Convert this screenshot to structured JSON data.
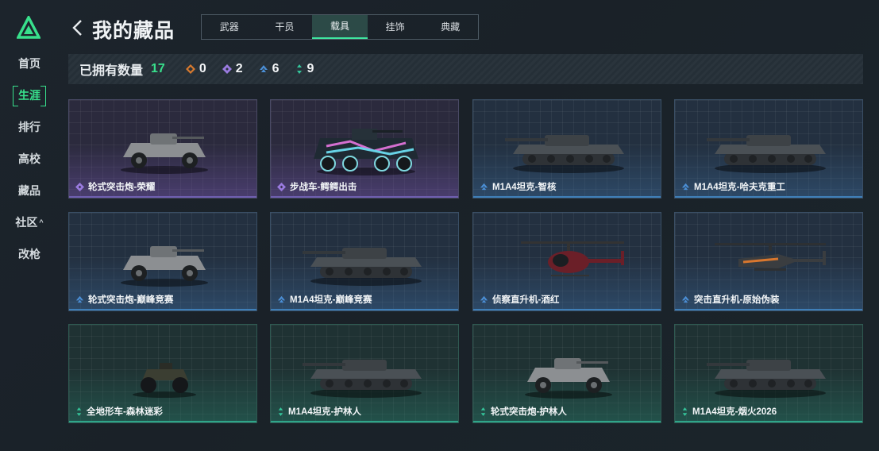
{
  "sidebar": {
    "logo_icon": "triangle-logo-icon",
    "items": [
      {
        "label": "首页",
        "active": false
      },
      {
        "label": "生涯",
        "active": true
      },
      {
        "label": "排行",
        "active": false
      },
      {
        "label": "高校",
        "active": false
      },
      {
        "label": "藏品",
        "active": false
      },
      {
        "label": "社区",
        "active": false,
        "caret": "^"
      },
      {
        "label": "改枪",
        "active": false
      }
    ]
  },
  "header": {
    "back_icon": "chevron-left-icon",
    "title": "我的藏品",
    "tabs": [
      {
        "label": "武器",
        "active": false
      },
      {
        "label": "干员",
        "active": false
      },
      {
        "label": "载具",
        "active": true
      },
      {
        "label": "挂饰",
        "active": false
      },
      {
        "label": "典藏",
        "active": false
      }
    ]
  },
  "stats": {
    "label": "已拥有数量",
    "total": "17",
    "rarity_counts": [
      {
        "icon": "diamond-orange-icon",
        "color": "#d97a2e",
        "count": "0"
      },
      {
        "icon": "diamond-purple-icon",
        "color": "#9a7be0",
        "count": "2"
      },
      {
        "icon": "chevron-blue-icon",
        "color": "#4b8fd6",
        "count": "6"
      },
      {
        "icon": "arrows-green-icon",
        "color": "#35c79c",
        "count": "9"
      }
    ]
  },
  "colors": {
    "accent": "#38e08c",
    "epic": "#8a6fd8",
    "rare": "#4b8fd6",
    "common": "#35c79c"
  },
  "items": [
    {
      "name": "轮式突击炮-荣耀",
      "rarity": "epic",
      "icon": "wheeled-assault-gun-icon"
    },
    {
      "name": "步战车-鳄鳄出击",
      "rarity": "epic",
      "icon": "infantry-vehicle-icon"
    },
    {
      "name": "M1A4坦克-智核",
      "rarity": "rare",
      "icon": "tank-icon"
    },
    {
      "name": "M1A4坦克-哈夫克重工",
      "rarity": "rare",
      "icon": "tank-icon"
    },
    {
      "name": "轮式突击炮-巅峰竞赛",
      "rarity": "rare",
      "icon": "wheeled-assault-gun-icon"
    },
    {
      "name": "M1A4坦克-巅峰竞赛",
      "rarity": "rare",
      "icon": "tank-icon"
    },
    {
      "name": "侦察直升机-酒红",
      "rarity": "rare",
      "icon": "scout-helicopter-icon"
    },
    {
      "name": "突击直升机-原始伪装",
      "rarity": "rare",
      "icon": "attack-helicopter-icon"
    },
    {
      "name": "全地形车-森林迷彩",
      "rarity": "common",
      "icon": "atv-icon"
    },
    {
      "name": "M1A4坦克-护林人",
      "rarity": "common",
      "icon": "tank-icon"
    },
    {
      "name": "轮式突击炮-护林人",
      "rarity": "common",
      "icon": "wheeled-assault-gun-icon"
    },
    {
      "name": "M1A4坦克-烟火2026",
      "rarity": "common",
      "icon": "tank-icon"
    }
  ]
}
